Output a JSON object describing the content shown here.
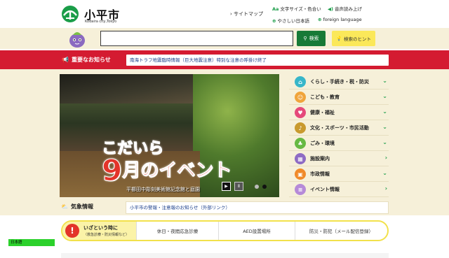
{
  "header": {
    "city_name": "小平市",
    "city_sub": "Kodaira city,Tokyo",
    "sitemap": "サイトマップ",
    "links": [
      {
        "label": "文字サイズ・色合い",
        "icon": "text-size-icon"
      },
      {
        "label": "音声読み上げ",
        "icon": "speaker-icon"
      },
      {
        "label": "やさしい日本語",
        "icon": "globe-icon"
      },
      {
        "label": "foreign language",
        "icon": "globe-icon"
      }
    ]
  },
  "search": {
    "placeholder": "",
    "button_label": "検索",
    "hint_label": "検索のヒント"
  },
  "notice": {
    "label": "重要なお知らせ",
    "text": "南海トラフ地震臨時情報（巨大地震注意）特別な注意の呼掛け終了"
  },
  "hero": {
    "title_line1": "こだいら",
    "title_num": "9",
    "title_line2": "月のイベント",
    "caption": "平櫛田中彫刻美術館記念館と庭園",
    "play": "▶",
    "pause": "Ⅱ"
  },
  "menu": [
    {
      "label": "くらし・手続き・税・防災",
      "icon": "home-icon",
      "color": "#37b6c9"
    },
    {
      "label": "こども・教育",
      "icon": "child-icon",
      "color": "#f0a43b"
    },
    {
      "label": "健康・福祉",
      "icon": "heart-icon",
      "color": "#e5497a"
    },
    {
      "label": "文化・スポーツ・市民活動",
      "icon": "culture-icon",
      "color": "#c99a2e"
    },
    {
      "label": "ごみ・環境",
      "icon": "leaf-icon",
      "color": "#67b943"
    },
    {
      "label": "施設案内",
      "icon": "building-icon",
      "color": "#8e6bc4"
    },
    {
      "label": "市政情報",
      "icon": "city-icon",
      "color": "#f08a2a"
    },
    {
      "label": "イベント情報",
      "icon": "event-icon",
      "color": "#b68ad8"
    }
  ],
  "weather": {
    "label": "気象情報",
    "link": "小平市の警報・注意報のお知らせ（外部リンク）"
  },
  "emergency": {
    "title": "いざという時に",
    "sub": "（救急診療・防災情報など）",
    "links": [
      "休日・夜間応急診療",
      "AED設置場所",
      "防災・防犯（メール配信登録）"
    ]
  },
  "lang_badge": "日本語",
  "colors": {
    "accent": "#1a9d48",
    "notice": "#d41b31",
    "cream": "#f6f0d9"
  }
}
